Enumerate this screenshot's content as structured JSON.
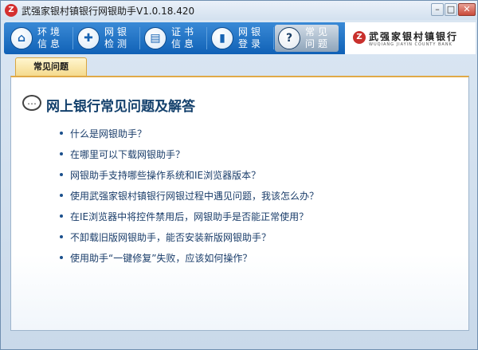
{
  "window": {
    "title": "武强家银村镇银行网银助手V1.0.18.420",
    "app_icon_glyph": "Z",
    "minimize_glyph": "–",
    "maximize_glyph": "□",
    "close_glyph": "✕"
  },
  "nav": {
    "items": [
      {
        "label": "环境信息",
        "icon": "home-icon",
        "glyph": "⌂"
      },
      {
        "label": "网银检测",
        "icon": "stethoscope-icon",
        "glyph": "✚"
      },
      {
        "label": "证书信息",
        "icon": "certificate-icon",
        "glyph": "▤"
      },
      {
        "label": "网银登录",
        "icon": "phone-icon",
        "glyph": "▮"
      },
      {
        "label": "常见问题",
        "icon": "question-icon",
        "glyph": "?",
        "active": true
      }
    ]
  },
  "logo": {
    "mark_glyph": "Z",
    "name_cn": "武强家银村镇银行",
    "name_en": "WUQIANG JIAYIN COUNTY BANK"
  },
  "tabs": [
    {
      "label": "常见问题"
    }
  ],
  "faq": {
    "icon_glyph": "…",
    "title": "网上银行常见问题及解答",
    "questions": [
      "什么是网银助手？",
      "在哪里可以下载网银助手？",
      "网银助手支持哪些操作系统和IE浏览器版本？",
      "使用武强家银村镇银行网银过程中遇见问题，我该怎么办？",
      "在IE浏览器中将控件禁用后，网银助手是否能正常使用？",
      "不卸载旧版网银助手，能否安装新版网银助手？",
      "使用助手“一键修复”失败，应该如何操作？"
    ]
  }
}
